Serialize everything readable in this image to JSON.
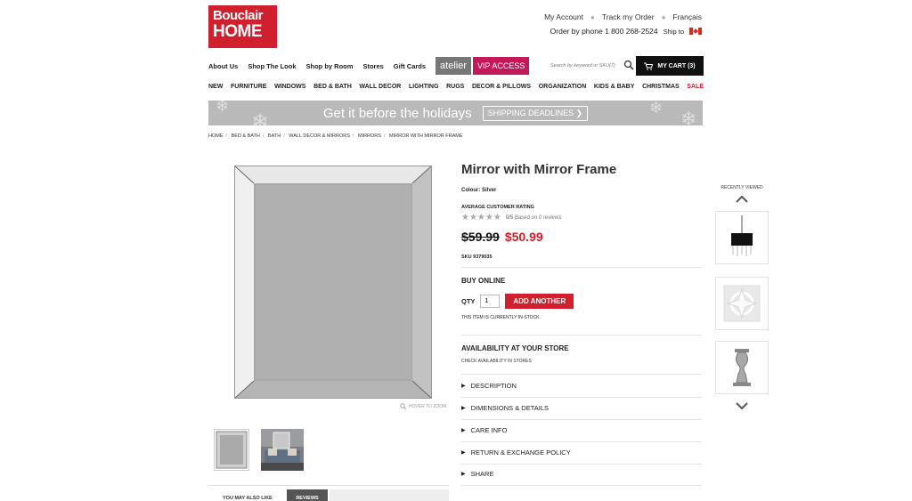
{
  "brand": {
    "line1": "Bouclair",
    "line2": "HOME"
  },
  "top_links": {
    "account": "My Account",
    "track": "Track my Order",
    "lang": "Français"
  },
  "phone": {
    "text": "Order by phone 1 800 268-2524",
    "ship": "Ship to"
  },
  "nav": {
    "items": [
      "About Us",
      "Shop The Look",
      "Shop by Room",
      "Stores",
      "Gift Cards"
    ],
    "atelier": "atelier",
    "vip": "VIP ACCESS",
    "search_placeholder": "Search by keyword or SKU(7)",
    "cart": "MY CART (3)"
  },
  "categories": [
    "NEW",
    "FURNITURE",
    "WINDOWS",
    "BED & BATH",
    "WALL DECOR",
    "LIGHTING",
    "RUGS",
    "DECOR & PILLOWS",
    "ORGANIZATION",
    "KIDS & BABY",
    "CHRISTMAS",
    "SALE"
  ],
  "banner": {
    "message": "Get it before the holidays",
    "button": "SHIPPING DEADLINES ❯"
  },
  "breadcrumb": [
    "HOME",
    "BED & BATH",
    "BATH",
    "WALL DECOR & MIRRORS",
    "MIRRORS",
    "MIRROR WITH MIRROR FRAME"
  ],
  "product": {
    "title": "Mirror with Mirror Frame",
    "colour": "Colour: Silver",
    "rating_label": "AVERAGE CUSTOMER RATING",
    "rating_value": "0/5",
    "rating_note": "Based on 0 reviews",
    "stars_filled": 0,
    "old_price": "$59.99",
    "new_price": "$50.99",
    "sku": "SKU 9379035",
    "buy_online": "BUY ONLINE",
    "qty_label": "QTY",
    "qty_value": "1",
    "add_button": "ADD ANOTHER",
    "stock": "THIS ITEM IS CURRENTLY IN-STOCK.",
    "availability": "AVAILABILITY AT YOUR STORE",
    "check_availability": "CHECK AVAILABILITY IN STORES",
    "hover_zoom": "HOVER TO ZOOM",
    "accordion": [
      "DESCRIPTION",
      "DIMENSIONS & DETAILS",
      "CARE INFO",
      "RETURN & EXCHANGE POLICY",
      "SHARE"
    ]
  },
  "bottom_tabs": {
    "also_like": "YOU MAY ALSO LIKE",
    "reviews": "REVIEWS"
  },
  "recently_viewed": {
    "title": "RECENTLY VIEWED"
  },
  "colors": {
    "brand_red": "#d0202e",
    "vip_pink": "#c4185a",
    "banner_grey": "#b9b9b9"
  }
}
